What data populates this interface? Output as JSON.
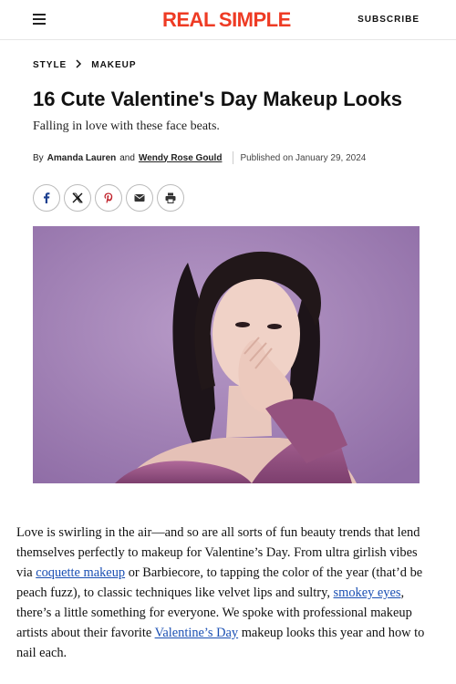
{
  "header": {
    "logo_part1": "REAL",
    "logo_part2": "SIMPLE",
    "subscribe_label": "SUBSCRIBE",
    "menu_icon": "hamburger-menu-icon"
  },
  "breadcrumb": {
    "items": [
      "STYLE",
      "MAKEUP"
    ],
    "separator_icon": "chevron-right-icon"
  },
  "article": {
    "title": "16 Cute Valentine's Day Makeup Looks",
    "subtitle": "Falling in love with these face beats.",
    "by_label": "By",
    "author1": "Amanda Lauren",
    "and_label": "and",
    "author2": "Wendy Rose Gould",
    "published": "Published on January 29, 2024"
  },
  "share_buttons": [
    {
      "icon": "facebook-icon"
    },
    {
      "icon": "x-twitter-icon"
    },
    {
      "icon": "pinterest-icon"
    },
    {
      "icon": "email-icon"
    },
    {
      "icon": "print-icon"
    }
  ],
  "body": {
    "p1_a": "Love is swirling in the air—and so are all sorts of fun beauty trends that lend themselves perfectly to makeup for Valentine’s Day. From ultra girlish vibes via ",
    "link1": "coquette makeup",
    "p1_b": " or Barbiecore, to tapping the color of the year (that’d be peach fuzz), to classic techniques like velvet lips and sultry, ",
    "link2": "smokey eyes",
    "p1_c": ", there’s a little something for everyone. We spoke with professional makeup artists about their favorite ",
    "link3": "Valentine’s Day",
    "p1_d": " makeup looks this year and how to nail each."
  },
  "colors": {
    "brand_red": "#ee3b24",
    "link_blue": "#1a4fb3",
    "hero_background": "#a584b8"
  }
}
